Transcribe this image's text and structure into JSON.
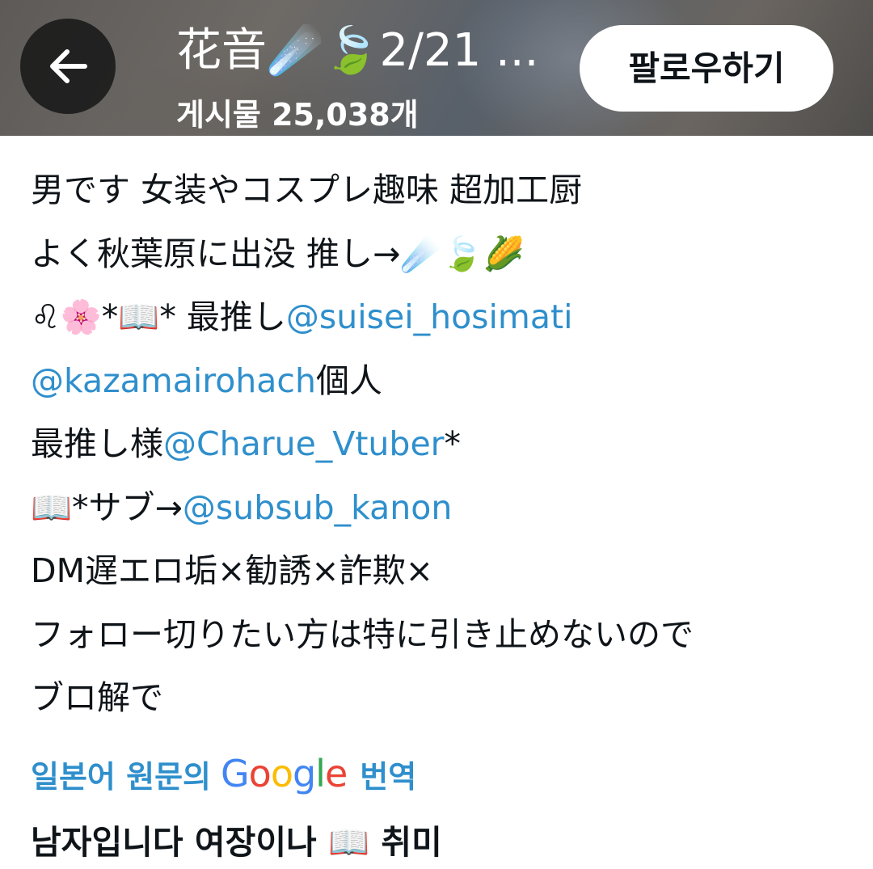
{
  "header": {
    "back_icon": "arrow-left-icon",
    "title": "花音☄️🍃2/21 ...",
    "post_count": "게시물 25,038개",
    "follow_label": "팔로우하기"
  },
  "bio": {
    "line1": "男です 女装やコスプレ趣味 超加工厨",
    "line2": "よく秋葉原に出没 推し→☄️🍃🌽",
    "line3_prefix": "♌🌸*📖* 最推し",
    "mention1": "@suisei_hosimati",
    "mention2": "@kazamairohach",
    "line4_suffix": "個人",
    "line5_prefix": "最推し様",
    "mention3": "@Charue_Vtuber",
    "line5_suffix": "*",
    "line6_prefix": "📖*サブ→",
    "mention4": "@subsub_kanon",
    "line7": "DM遅エロ垢×勧誘×詐欺×",
    "line8": "フォロー切りたい方は特に引き止めないので",
    "line9": "ブロ解で"
  },
  "translate": {
    "prefix": "일본어 원문의",
    "logo_g1": "G",
    "logo_o1": "o",
    "logo_o2": "o",
    "logo_g2": "g",
    "logo_l": "l",
    "logo_e": "e",
    "suffix": "번역"
  },
  "translated_text": "남자입니다 여장이나 📖 취미",
  "colors": {
    "mention": "#2f8fcc",
    "text": "#0f1419",
    "google_blue": "#4285f4",
    "google_red": "#ea4335",
    "google_yellow": "#fbbc05",
    "google_green": "#34a853"
  }
}
